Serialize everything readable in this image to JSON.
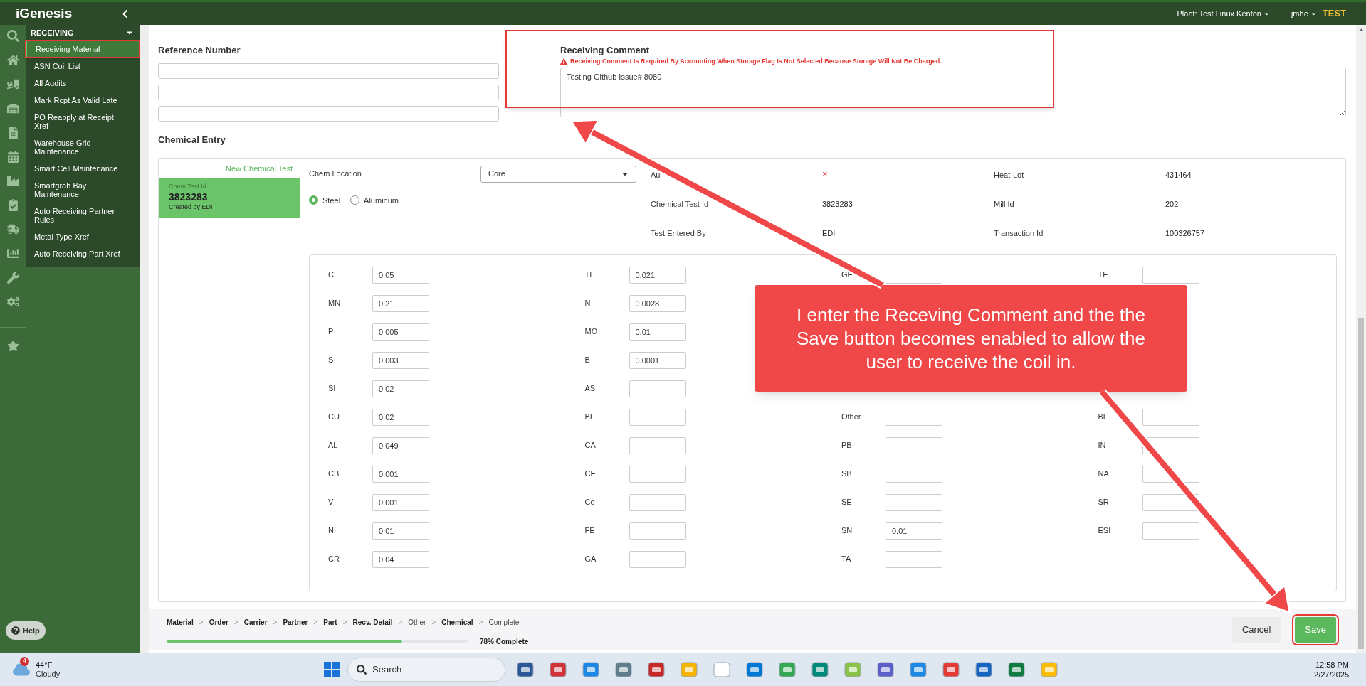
{
  "header": {
    "logo": "iGenesis",
    "plant": "Plant: Test Linux Kenton",
    "user": "jmhe",
    "env": "TEST"
  },
  "sidebar": {
    "section": "RECEIVING",
    "expanded": true,
    "items": [
      {
        "label": "Receiving Material",
        "selected": true,
        "highlighted": true
      },
      {
        "label": "ASN Coil List",
        "selected": false,
        "highlighted": false
      },
      {
        "label": "All Audits",
        "selected": false,
        "highlighted": false
      },
      {
        "label": "Mark Rcpt As Valid Late",
        "selected": false,
        "highlighted": false
      },
      {
        "label": "PO Reapply at Receipt Xref",
        "selected": false,
        "highlighted": false
      },
      {
        "label": "Warehouse Grid Maintenance",
        "selected": false,
        "highlighted": false
      },
      {
        "label": "Smart Cell Maintenance",
        "selected": false,
        "highlighted": false
      },
      {
        "label": "Smartgrab Bay Maintenance",
        "selected": false,
        "highlighted": false
      },
      {
        "label": "Auto Receiving Partner Rules",
        "selected": false,
        "highlighted": false
      },
      {
        "label": "Metal Type Xref",
        "selected": false,
        "highlighted": false
      },
      {
        "label": "Auto Receiving Part Xref",
        "selected": false,
        "highlighted": false
      }
    ],
    "help": "Help"
  },
  "reference": {
    "label": "Reference Number"
  },
  "comment": {
    "label": "Receiving Comment",
    "warning": "Receiving Comment Is Required By Accounting When Storage Flag Is Not Selected Because Storage Will Not Be Charged.",
    "value": "Testing Github Issue# 8080",
    "highlighted": true
  },
  "chemical": {
    "title": "Chemical Entry",
    "new_link": "New Chemical Test",
    "tests": [
      {
        "label": "Chem Test Id",
        "id": "3823283",
        "created": "Created by EDI",
        "selected": true
      }
    ],
    "location": {
      "label": "Chem Location",
      "value": "Core"
    },
    "metals": [
      {
        "label": "Steel",
        "selected": true
      },
      {
        "label": "Aluminum",
        "selected": false
      }
    ],
    "info": [
      {
        "label": "Au",
        "value": "×",
        "kind": "mark"
      },
      {
        "label": "Heat-Lot",
        "value": "431464",
        "kind": "text"
      },
      {
        "label": "Chemical Test Id",
        "value": "3823283",
        "kind": "text"
      },
      {
        "label": "Mill Id",
        "value": "202",
        "kind": "text"
      },
      {
        "label": "Test Entered By",
        "value": "EDI",
        "kind": "text"
      },
      {
        "label": "Transaction Id",
        "value": "100326757",
        "kind": "text"
      }
    ],
    "elements": [
      [
        {
          "kind": "field",
          "label": "C",
          "value": "0.05"
        },
        {
          "kind": "field",
          "label": "MN",
          "value": "0.21"
        },
        {
          "kind": "field",
          "label": "P",
          "value": "0.005"
        },
        {
          "kind": "field",
          "label": "S",
          "value": "0.003"
        },
        {
          "kind": "field",
          "label": "SI",
          "value": "0.02"
        },
        {
          "kind": "field",
          "label": "CU",
          "value": "0.02"
        },
        {
          "kind": "field",
          "label": "AL",
          "value": "0.049"
        },
        {
          "kind": "field",
          "label": "CB",
          "value": "0.001"
        },
        {
          "kind": "field",
          "label": "V",
          "value": "0.001"
        },
        {
          "kind": "field",
          "label": "NI",
          "value": "0.01"
        },
        {
          "kind": "field",
          "label": "CR",
          "value": "0.04"
        }
      ],
      [
        {
          "kind": "field",
          "label": "TI",
          "value": "0.021"
        },
        {
          "kind": "field",
          "label": "N",
          "value": "0.0028"
        },
        {
          "kind": "field",
          "label": "MO",
          "value": "0.01"
        },
        {
          "kind": "field",
          "label": "B",
          "value": "0.0001"
        },
        {
          "kind": "field",
          "label": "AS"
        },
        {
          "kind": "field",
          "label": "BI"
        },
        {
          "kind": "field",
          "label": "CA"
        },
        {
          "kind": "field",
          "label": "CE"
        },
        {
          "kind": "field",
          "label": "Co"
        },
        {
          "kind": "field",
          "label": "FE"
        },
        {
          "kind": "field",
          "label": "GA"
        }
      ],
      [
        {
          "kind": "field",
          "label": "GE"
        },
        {
          "kind": "covered"
        },
        {
          "kind": "covered"
        },
        {
          "kind": "covered"
        },
        {
          "kind": "covered"
        },
        {
          "kind": "field",
          "label": "Other"
        },
        {
          "kind": "field",
          "label": "PB"
        },
        {
          "kind": "field",
          "label": "SB"
        },
        {
          "kind": "field",
          "label": "SE"
        },
        {
          "kind": "field",
          "label": "SN",
          "value": "0.01"
        },
        {
          "kind": "field",
          "label": "TA"
        }
      ],
      [
        {
          "kind": "field",
          "label": "TE"
        },
        {
          "kind": "covered"
        },
        {
          "kind": "covered"
        },
        {
          "kind": "covered"
        },
        {
          "kind": "covered"
        },
        {
          "kind": "field",
          "label": "BE"
        },
        {
          "kind": "field",
          "label": "IN"
        },
        {
          "kind": "field",
          "label": "NA"
        },
        {
          "kind": "field",
          "label": "SR"
        },
        {
          "kind": "field",
          "label": "ESI"
        },
        {
          "kind": "empty"
        }
      ]
    ]
  },
  "callout": {
    "text": "I enter the Receving Comment and the the Save button becomes enabled to allow the user to receive the coil in."
  },
  "progress": {
    "separator": ">",
    "steps": [
      {
        "label": "Material",
        "done": true
      },
      {
        "label": "Order",
        "done": true
      },
      {
        "label": "Carrier",
        "done": true
      },
      {
        "label": "Partner",
        "done": true
      },
      {
        "label": "Part",
        "done": true
      },
      {
        "label": "Recv. Detail",
        "done": true
      },
      {
        "label": "Other",
        "done": false
      },
      {
        "label": "Chemical",
        "done": true
      },
      {
        "label": "Complete",
        "done": false
      }
    ],
    "level": 0.78,
    "reading": "78% Complete"
  },
  "buttons": {
    "cancel": "Cancel",
    "save": "Save",
    "save_highlighted": true
  },
  "taskbar": {
    "badge": "4",
    "temp": "44°F",
    "condition": "Cloudy",
    "search": "Search",
    "time": "12:58 PM",
    "date": "2/27/2025"
  }
}
